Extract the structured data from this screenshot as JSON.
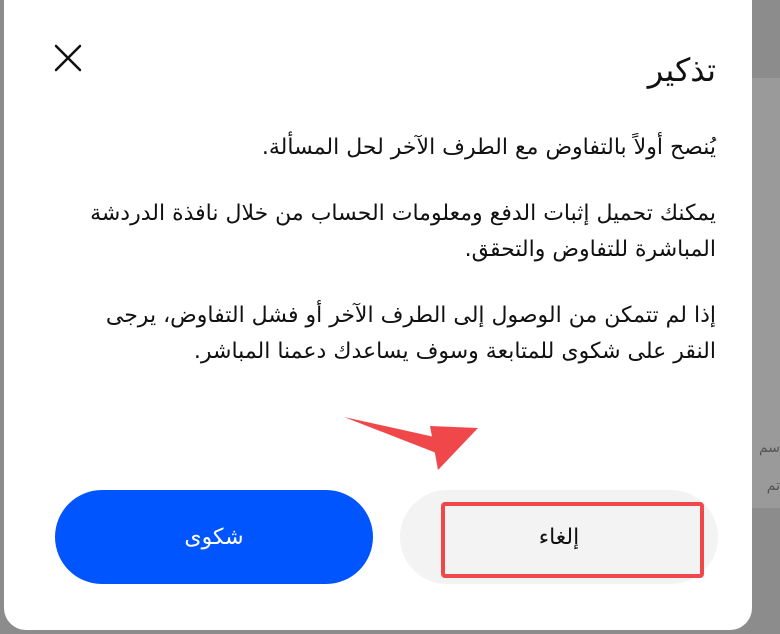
{
  "background": {
    "partial_text_1": "سم",
    "partial_text_2": "تم"
  },
  "dialog": {
    "title": "تذكير",
    "close_icon": "close-icon",
    "paragraphs": [
      "يُنصح أولاً بالتفاوض مع الطرف الآخر لحل المسألة.",
      "يمكنك تحميل إثبات الدفع ومعلومات الحساب من خلال نافذة الدردشة المباشرة للتفاوض والتحقق.",
      "إذا لم تتمكن من الوصول إلى الطرف الآخر أو فشل التفاوض، يرجى النقر على شكوى للمتابعة وسوف يساعدك دعمنا المباشر."
    ],
    "buttons": {
      "complaint_label": "شكوى",
      "cancel_label": "إلغاء"
    }
  },
  "colors": {
    "primary": "#0155ff",
    "annotation": "#f0484a"
  }
}
